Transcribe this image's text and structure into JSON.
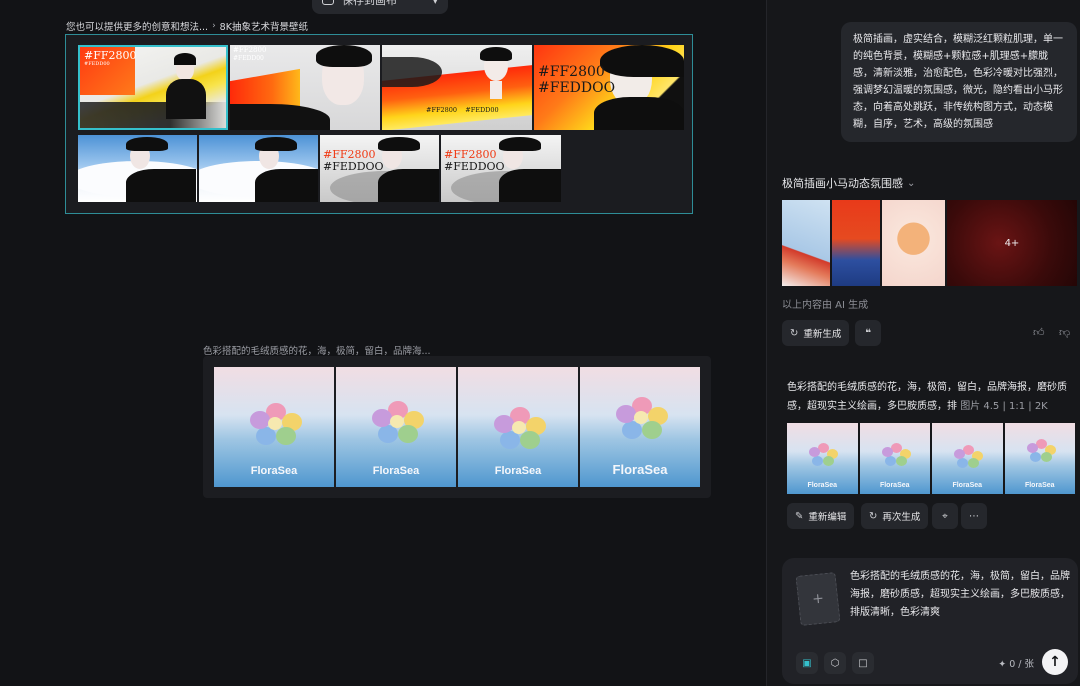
{
  "top_toolbar": {
    "label": "保存到画布",
    "icon": "canvas-icon"
  },
  "canvas": {
    "breadcrumb": {
      "first": "您也可以提供更多的创意和想法...",
      "second": "8K抽象艺术背景壁纸"
    },
    "group_a": {
      "thumbs_row1": [
        {
          "hex_big": "#FF2800",
          "hex_small": "#FEDD00"
        },
        {
          "hex_big": "#FF2800",
          "hex_small": "#FEDD00"
        },
        {
          "hex_big": "",
          "hex_small": "#FF2800    #FEDD00"
        },
        {
          "hex_big": "#FF2800",
          "hex_small": "#FEDDOO"
        }
      ],
      "thumbs_row2": [
        {
          "hex_big": "",
          "hex_small": ""
        },
        {
          "hex_big": "",
          "hex_small": ""
        },
        {
          "hex_big": "#FF2800",
          "hex_small": "#FEDDOO"
        },
        {
          "hex_big": "#FF2800",
          "hex_small": "#FEDDOO"
        }
      ]
    },
    "group_b": {
      "caption": "色彩搭配的毛绒质感的花，海，极简，留白，品牌海...",
      "brand": "FloraSea"
    }
  },
  "chat": {
    "user_prompt_1": "极简插画，虚实结合，模糊泛红颗粒肌理，单一的纯色背景，模糊感+颗粒感+肌理感+朦胧感，清新淡雅，治愈配色，色彩冷暖对比强烈，强调梦幻温暖的氛围感，微光，隐约看出小马形态，向着高处跳跃，非传统构图方式，动态模糊，自序，艺术，高级的氛围感",
    "result_title": "极简插画小马动态氛围感",
    "more_count": "4+",
    "ai_note": "以上内容由 AI 生成",
    "regenerate_label": "重新生成",
    "prompt_2": "色彩搭配的毛绒质感的花，海，极简，留白，品牌海报，磨砂质感，超现实主义绘画，多巴胺质感，排",
    "prompt_2_meta": "图片 4.5  |  1:1  |  2K",
    "re_edit_label": "重新编辑",
    "again_label": "再次生成",
    "composer_text": "色彩搭配的毛绒质感的花，海，极简，留白，品牌海报，磨砂质感，超现实主义绘画，多巴胺质感，排版清晰，色彩清爽",
    "cost": "0 / 张",
    "colors": {
      "accent": "#2e8d97",
      "panel": "#1b1c20",
      "bubble": "#25272c"
    }
  }
}
